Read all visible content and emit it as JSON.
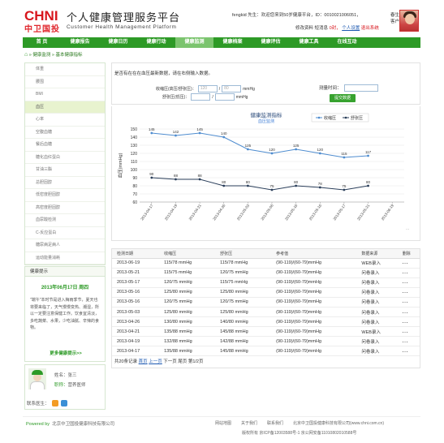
{
  "header": {
    "logo": "CHNI",
    "logo_sub": "中卫国投",
    "title": "个人健康管理服务平台",
    "title_en": "Customer Health Management Platform",
    "welcome": "fengkid 先生：欢迎您来到50岁健康平台，ID：0010021006051，",
    "user_right_1": "春生",
    "user_right_2": "客户",
    "links_prefix": "修改资料",
    "links_msg": "短消息",
    "links_msg_count": "0封，",
    "links_logout": "个人设置",
    "links_exit": "退出系统"
  },
  "nav": [
    "首 页",
    "健康报告",
    "健康日历",
    "健康行动",
    "健康监测",
    "健康档案",
    "健康评估",
    "健康工具",
    "在线互动"
  ],
  "nav_active": 4,
  "breadcrumb": {
    "level1": "健康监测",
    "level2": "基本健康指标"
  },
  "sidebar": [
    "体重",
    "腰围",
    "BMI",
    "血压",
    "心率",
    "空腹血糖",
    "餐后血糖",
    "糖化血红蛋白",
    "甘油三酯",
    "总胆固醇",
    "低密度胆固醇",
    "高密度胆固醇",
    "血尿酸检测",
    "C-反应蛋白",
    "糖尿病足病人",
    "运动能量消耗"
  ],
  "sidebar_active": 3,
  "tips": {
    "title": "健康提示",
    "date": "2013年06月17日  周四",
    "body": "\"端午\"本时节是进入梅雨季节，夏天也将要来临了，天气慢慢变热、潮湿，所以一定要注意保健工作。饮食宜清淡，多吃蔬菜、水果，少吃油腻、辛辣的食物。",
    "more": "更多健康提示>>"
  },
  "profile": {
    "name_label": "姓名：",
    "name": "张三",
    "role_label": "职称：",
    "role": "营养医师",
    "contact_label": "联系医生："
  },
  "form": {
    "hint": "是否有在在在血压最新数据，请在右侧输入数据。",
    "sys_label": "收缩压(高压/舒张压)：",
    "sys_val": "120",
    "sys_val2": "80",
    "unit": "mmHg",
    "dia_label": "舒张压(低压)：",
    "time_label": "测量时间：",
    "submit": "提交数据"
  },
  "chart_data": {
    "type": "line",
    "title": "健康监测指标",
    "subtitle": "血压监测",
    "ylabel": "血压(mmHg)",
    "ylim": [
      60,
      150
    ],
    "yticks": [
      60,
      70,
      80,
      90,
      100,
      110,
      120,
      130,
      140,
      150
    ],
    "categories": [
      "2013-04-17",
      "2013-04-19",
      "2013-04-21",
      "2013-04-26",
      "2013-05-03",
      "2013-05-06",
      "2013-05-16",
      "2013-05-16",
      "2013-05-17",
      "2013-05-21",
      "2013-06-19"
    ],
    "legend": [
      "收缩压",
      "舒张压"
    ],
    "legend_position": "top-right",
    "series": [
      {
        "name": "收缩压",
        "values": [
          145,
          142,
          145,
          140,
          125,
          120,
          125,
          120,
          115,
          117
        ],
        "color": "#4e8ccf"
      },
      {
        "name": "舒张压",
        "values": [
          90,
          88,
          88,
          80,
          80,
          75,
          80,
          78,
          75,
          80
        ],
        "color": "#2a3e5a"
      }
    ],
    "series_labels": {
      "top": [
        145,
        142,
        145,
        140,
        125,
        120,
        125,
        120,
        115,
        117
      ],
      "bottom": [
        90,
        88,
        88,
        80,
        80,
        75,
        80,
        78,
        75,
        80
      ]
    }
  },
  "table": {
    "headers": [
      "检测日期",
      "收缩压",
      "舒张压",
      "参考值",
      "数据来源",
      "删除"
    ],
    "rows": [
      [
        "2013-06-19",
        "115/78 mmHg",
        "115/78 mmHg",
        "(90-119)/(60-79)mmHg",
        "WEB录入",
        "..."
      ],
      [
        "2013-05-21",
        "115/75 mmHg",
        "120/75 mmHg",
        "(90-119)/(60-79)mmHg",
        "问卷录入",
        "..."
      ],
      [
        "2013-05-17",
        "120/75 mmHg",
        "115/75 mmHg",
        "(90-119)/(60-79)mmHg",
        "问卷录入",
        "..."
      ],
      [
        "2013-05-16",
        "125/80 mmHg",
        "125/80 mmHg",
        "(90-119)/(60-79)mmHg",
        "问卷录入",
        "..."
      ],
      [
        "2013-05-16",
        "120/75 mmHg",
        "120/75 mmHg",
        "(90-119)/(60-79)mmHg",
        "问卷录入",
        "..."
      ],
      [
        "2013-05-03",
        "125/80 mmHg",
        "125/80 mmHg",
        "(90-119)/(60-79)mmHg",
        "问卷录入",
        "..."
      ],
      [
        "2013-04-26",
        "130/80 mmHg",
        "140/80 mmHg",
        "(90-119)/(60-79)mmHg",
        "问卷录入",
        "..."
      ],
      [
        "2013-04-21",
        "135/88 mmHg",
        "145/88 mmHg",
        "(90-119)/(60-79)mmHg",
        "WEB录入",
        "..."
      ],
      [
        "2013-04-19",
        "132/88 mmHg",
        "142/88 mmHg",
        "(90-119)/(60-79)mmHg",
        "问卷录入",
        "..."
      ],
      [
        "2013-04-17",
        "135/88 mmHg",
        "145/88 mmHg",
        "(90-119)/(60-79)mmHg",
        "问卷录入",
        "..."
      ]
    ],
    "pager_total": "共20条记录",
    "pager_first": "首页",
    "pager_prev": "上一页",
    "pager_next": "下一页",
    "pager_last": "尾页",
    "pager_info": "第1/2页"
  },
  "footer": {
    "powered": "Powered by",
    "company": "北京中卫国投健康科技有限公司",
    "links": [
      "网站地图",
      "关于我们",
      "联系我们",
      "北京中卫国投健康科技有限公司(www.chni.com.cn)"
    ],
    "icp": "版权所有 京ICP备12003588号-1 京公网安备11010802010588号"
  }
}
